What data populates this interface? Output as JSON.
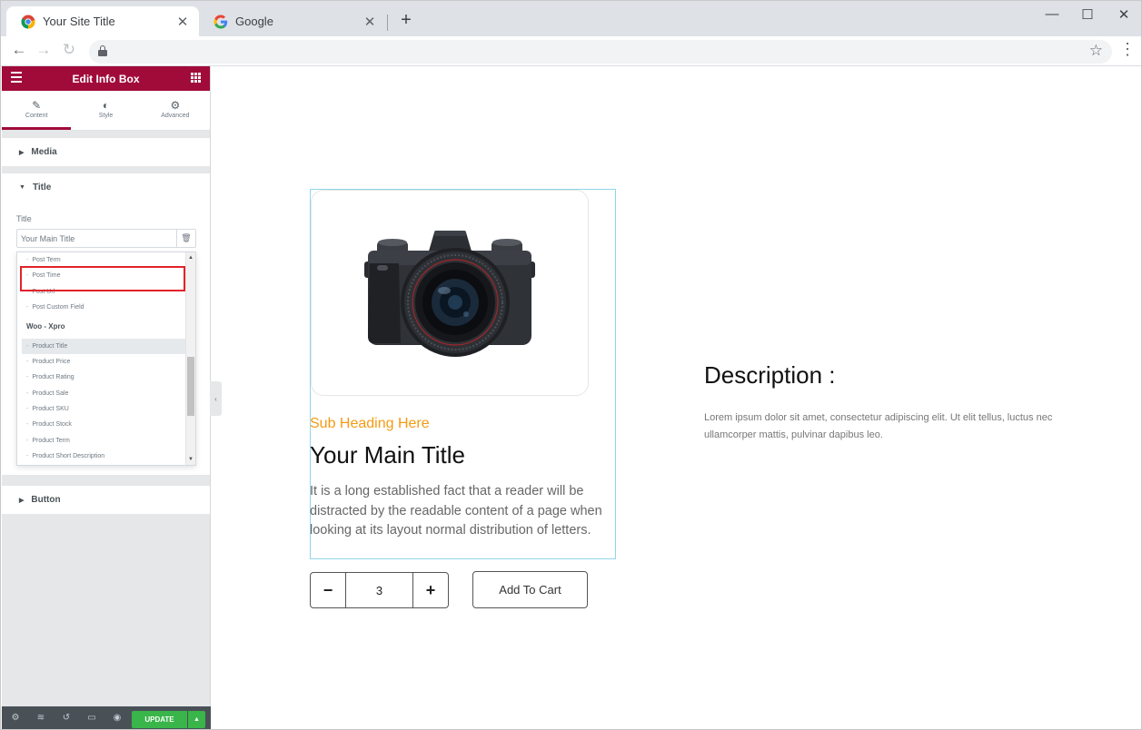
{
  "browser": {
    "tabs": [
      {
        "title": "Your Site Title",
        "active": true
      },
      {
        "title": "Google",
        "active": false
      }
    ]
  },
  "panel": {
    "header_title": "Edit Info Box",
    "tabs": [
      {
        "label": "Content",
        "icon": "pencil-icon",
        "active": true
      },
      {
        "label": "Style",
        "icon": "contrast-icon",
        "active": false
      },
      {
        "label": "Advanced",
        "icon": "gear-icon",
        "active": false
      }
    ],
    "sections": {
      "media": "Media",
      "title": "Title",
      "button": "Button"
    },
    "title_control": {
      "label": "Title",
      "value": "Your Main Title"
    },
    "dropdown": {
      "items_top": [
        "Post Term",
        "Post Time",
        "Post Url",
        "Post Custom Field"
      ],
      "group": "Woo - Xpro",
      "items_woo": [
        "Product Title",
        "Product Price",
        "Product Rating",
        "Product Sale",
        "Product SKU",
        "Product Stock",
        "Product Term",
        "Product Short Description"
      ],
      "selected": "Product Title"
    },
    "footer": {
      "update_label": "UPDATE"
    }
  },
  "content": {
    "sub_heading": "Sub Heading Here",
    "main_title": "Your Main Title",
    "description": "It is a long established fact that a reader will be distracted by the readable content of a page when looking at its layout normal distribution of letters.",
    "quantity": "3",
    "minus_label": "−",
    "plus_label": "+",
    "add_to_cart": "Add To Cart",
    "desc_title": "Description :",
    "desc_text": "Lorem ipsum dolor sit amet, consectetur adipiscing elit. Ut elit tellus, luctus nec ullamcorper mattis, pulvinar dapibus leo."
  },
  "colors": {
    "panel_header": "#a00b3a",
    "update_button": "#39b54a",
    "sub_heading": "#f59a13",
    "highlight_box": "#e2222a"
  }
}
